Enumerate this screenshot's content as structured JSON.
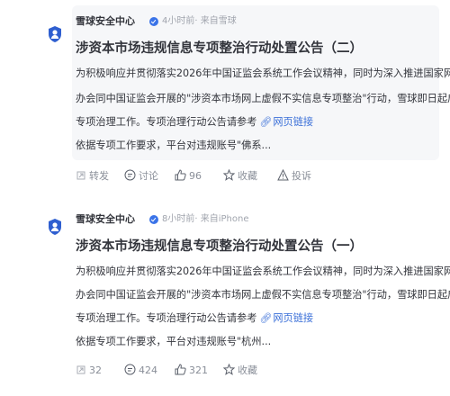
{
  "posts": [
    {
      "author": "雪球安全中心",
      "meta": "4小时前· 来自雪球",
      "title": "涉资本市场违规信息专项整治行动处置公告（二）",
      "body_lines": [
        "为积极响应并贯彻落实2026年中国证监会系统工作会议精神，同时为深入推进国家网信",
        "办会同中国证监会开展的\"涉资本市场网上虚假不实信息专项整治\"行动，雪球即日起启动",
        "专项治理工作。专项治理行动公告请参考"
      ],
      "link_text": "网页链接",
      "extra_line": "依据专项工作要求，平台对违规账号\"佛系...",
      "actions": {
        "repost": "转发",
        "comment": "讨论",
        "like": "96",
        "favorite": "收藏",
        "report": "投诉"
      }
    },
    {
      "author": "雪球安全中心",
      "meta": "8小时前· 来自iPhone",
      "title": "涉资本市场违规信息专项整治行动处置公告（一）",
      "body_lines": [
        "为积极响应并贯彻落实2026年中国证监会系统工作会议精神，同时为深入推进国家网信",
        "办会同中国证监会开展的\"涉资本市场网上虚假不实信息专项整治\"行动，雪球即日起启动",
        "专项治理工作。专项治理行动公告请参考"
      ],
      "link_text": "网页链接",
      "extra_line": "依据专项工作要求，平台对违规账号\"杭州...",
      "actions": {
        "repost": "32",
        "comment": "424",
        "like": "321",
        "favorite": "收藏"
      }
    }
  ],
  "colors": {
    "link": "#3a6fd8",
    "badge": "#3a73e8",
    "card_bg": "#f6f7f9",
    "meta_text": "#a1a5ae",
    "action_text": "#8a8f99"
  },
  "icons": {
    "avatar": "shield-person-icon",
    "verified": "verified-badge-icon",
    "link": "link-icon",
    "repost": "repost-icon",
    "comment": "comment-icon",
    "like": "thumbs-up-icon",
    "favorite": "star-icon",
    "report": "warning-triangle-icon"
  }
}
